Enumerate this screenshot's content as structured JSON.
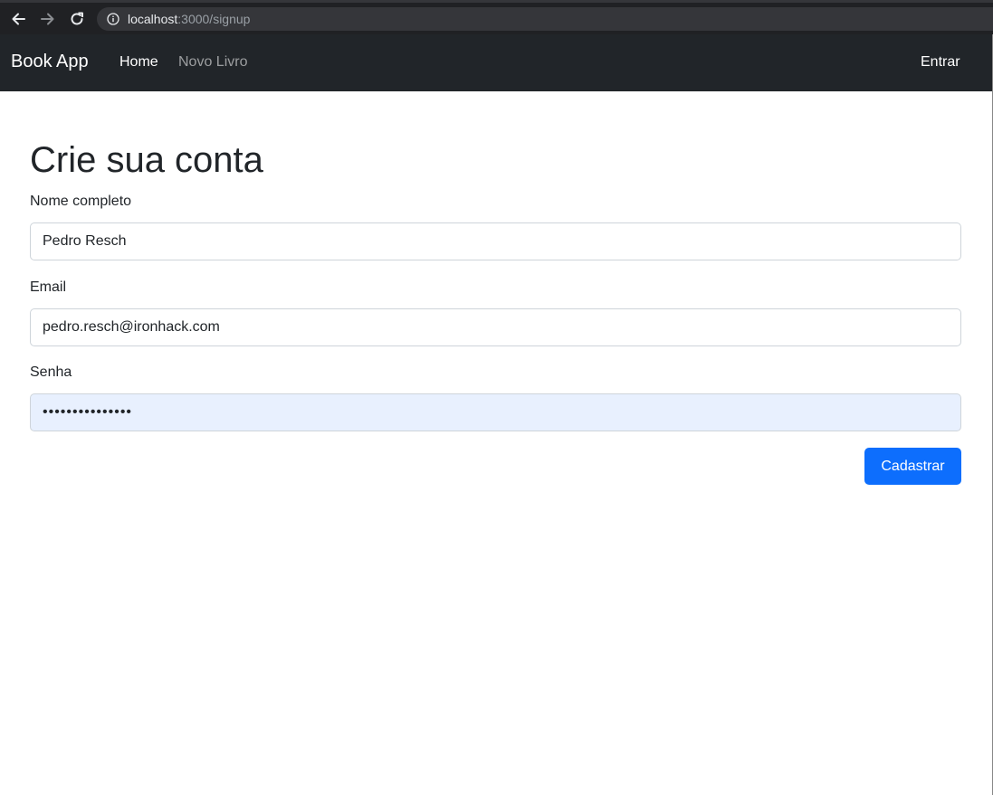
{
  "browser": {
    "url_host": "localhost",
    "url_path": ":3000/signup"
  },
  "navbar": {
    "brand": "Book App",
    "links": [
      "Home",
      "Novo Livro"
    ],
    "right_link": "Entrar"
  },
  "form": {
    "title": "Crie sua conta",
    "name_label": "Nome completo",
    "name_value": "Pedro Resch",
    "email_label": "Email",
    "email_value": "pedro.resch@ironhack.com",
    "password_label": "Senha",
    "password_value": "•••••••••••••••",
    "submit_label": "Cadastrar"
  },
  "colors": {
    "navbar_bg": "#212529",
    "primary": "#0d6efd",
    "autofill_bg": "#e8f0fe"
  }
}
